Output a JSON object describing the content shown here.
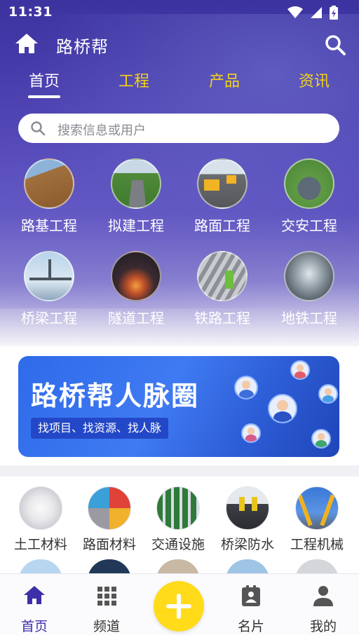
{
  "status": {
    "time": "11:31"
  },
  "app": {
    "title": "路桥帮"
  },
  "tabs": [
    {
      "label": "首页"
    },
    {
      "label": "工程"
    },
    {
      "label": "产品"
    },
    {
      "label": "资讯"
    }
  ],
  "search": {
    "placeholder": "搜索信息或用户"
  },
  "categories": [
    {
      "label": "路基工程"
    },
    {
      "label": "拟建工程"
    },
    {
      "label": "路面工程"
    },
    {
      "label": "交安工程"
    },
    {
      "label": "桥梁工程"
    },
    {
      "label": "隧道工程"
    },
    {
      "label": "铁路工程"
    },
    {
      "label": "地铁工程"
    }
  ],
  "banner": {
    "title": "路桥帮人脉圈",
    "subtitle": "找项目、找资源、找人脉"
  },
  "materials": [
    {
      "label": "土工材料"
    },
    {
      "label": "路面材料"
    },
    {
      "label": "交通设施"
    },
    {
      "label": "桥梁防水"
    },
    {
      "label": "工程机械"
    }
  ],
  "bottom_nav": [
    {
      "label": "首页",
      "icon": "home-icon"
    },
    {
      "label": "频道",
      "icon": "grid-icon"
    },
    {
      "label": "",
      "icon": "plus-icon"
    },
    {
      "label": "名片",
      "icon": "contact-card-icon"
    },
    {
      "label": "我的",
      "icon": "person-icon"
    }
  ],
  "colors": {
    "brand": "#3d2fa8",
    "tab_inactive": "#f5d21b",
    "fab": "#ffdb1a",
    "banner": "#2f6bea"
  }
}
